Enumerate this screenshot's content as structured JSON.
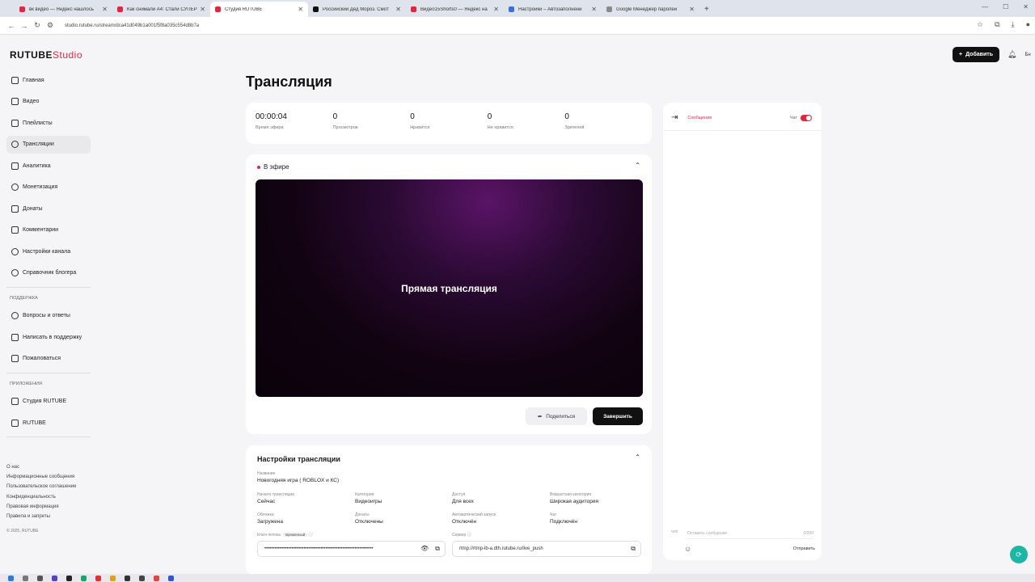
{
  "browser": {
    "tabs": [
      {
        "title": "вк видео — Яндекс нашлось",
        "color": "#e2263f"
      },
      {
        "title": "Как снимали А4: Стали СУПЕР",
        "color": "#e2263f"
      },
      {
        "title": "Студия RUTUBE",
        "color": "#e2263f",
        "active": true
      },
      {
        "title": "Российский Дед Мороз. Смот",
        "color": "#111111"
      },
      {
        "title": "Видео15Shorts0 — Яндекс на",
        "color": "#e2263f"
      },
      {
        "title": "Настройки – Автозаполнени",
        "color": "#3b6fd8"
      },
      {
        "title": "Google Менеджер паролей",
        "color": "#8a8a8a"
      }
    ],
    "url": "studio.rutube.ru/stream/dca41d049b1a001f5f8a035c554d8b7a"
  },
  "app": {
    "logo": "RUTUBE",
    "logo_studio": "Studio",
    "add_button": "Добавить",
    "page_title": "Трансляция"
  },
  "sidebar": {
    "items": [
      {
        "label": "Главная",
        "icon": "home-icon"
      },
      {
        "label": "Видео",
        "icon": "video-icon"
      },
      {
        "label": "Плейлисты",
        "icon": "playlist-icon"
      },
      {
        "label": "Трансляции",
        "icon": "broadcast-icon",
        "active": true
      },
      {
        "label": "Аналитика",
        "icon": "analytics-icon"
      },
      {
        "label": "Монетизация",
        "icon": "monetization-icon"
      },
      {
        "label": "Донаты",
        "icon": "donate-icon"
      },
      {
        "label": "Комментарии",
        "icon": "comments-icon"
      },
      {
        "label": "Настройки канала",
        "icon": "gear-icon"
      },
      {
        "label": "Справочник блогера",
        "icon": "info-icon"
      }
    ],
    "support_title": "ПОДДЕРЖКА",
    "support": [
      {
        "label": "Вопросы и ответы",
        "icon": "question-icon"
      },
      {
        "label": "Написать в поддержку",
        "icon": "mail-icon"
      },
      {
        "label": "Пожаловаться",
        "icon": "flag-icon"
      }
    ],
    "apps_title": "ПРИЛОЖЕНИЯ",
    "apps": [
      {
        "label": "Студия RUTUBE",
        "icon": "studio-icon"
      },
      {
        "label": "RUTUBE",
        "icon": "rutube-icon"
      }
    ],
    "footer_links": [
      "О нас",
      "Информационные сообщения",
      "Пользовательское соглашение",
      "Конфиденциальность",
      "Правовая информация",
      "Правила и запреты"
    ],
    "copyright": "© 2025, RUTUBE"
  },
  "stats": [
    {
      "value": "00:00:04",
      "label": "Время эфира"
    },
    {
      "value": "0",
      "label": "Просмотров"
    },
    {
      "value": "0",
      "label": "Нравится"
    },
    {
      "value": "0",
      "label": "Не нравится"
    },
    {
      "value": "0",
      "label": "Зрителей"
    }
  ],
  "live": {
    "status": "В эфире",
    "player_text": "Прямая трансляция",
    "share": "Поделиться",
    "end": "Завершить"
  },
  "settings": {
    "title": "Настройки трансляции",
    "name_label": "Название",
    "name_value": "Новогодняя игра ( ROBLOX и КС)",
    "fields": [
      {
        "label": "Начало трансляции",
        "value": "Сейчас"
      },
      {
        "label": "Категория",
        "value": "Видеоигры"
      },
      {
        "label": "Доступ",
        "value": "Для всех"
      },
      {
        "label": "Возрастная категория",
        "value": "Широкая аудитория"
      },
      {
        "label": "Обложка",
        "value": "Загружена"
      },
      {
        "label": "Донаты",
        "value": "Отключены"
      },
      {
        "label": "Автоматический запуск",
        "value": "Отключён"
      },
      {
        "label": "Чат",
        "value": "Подключён"
      }
    ],
    "key_label": "Ключ потока",
    "key_tag": "Временный",
    "key_value": "••••••••••••••••••••••••••••••••••••••••••••••••••••••••••••••••",
    "server_label": "Сервер",
    "server_value": "rtmp://rtmp-lb-a.dth.rutube.ru/live_push"
  },
  "chat": {
    "tab": "Сообщения",
    "toggle_label": "Чат",
    "input_placeholder": "Оставить сообщение",
    "counter": "0/200",
    "name": "ЧАТ",
    "send": "Отправить"
  }
}
